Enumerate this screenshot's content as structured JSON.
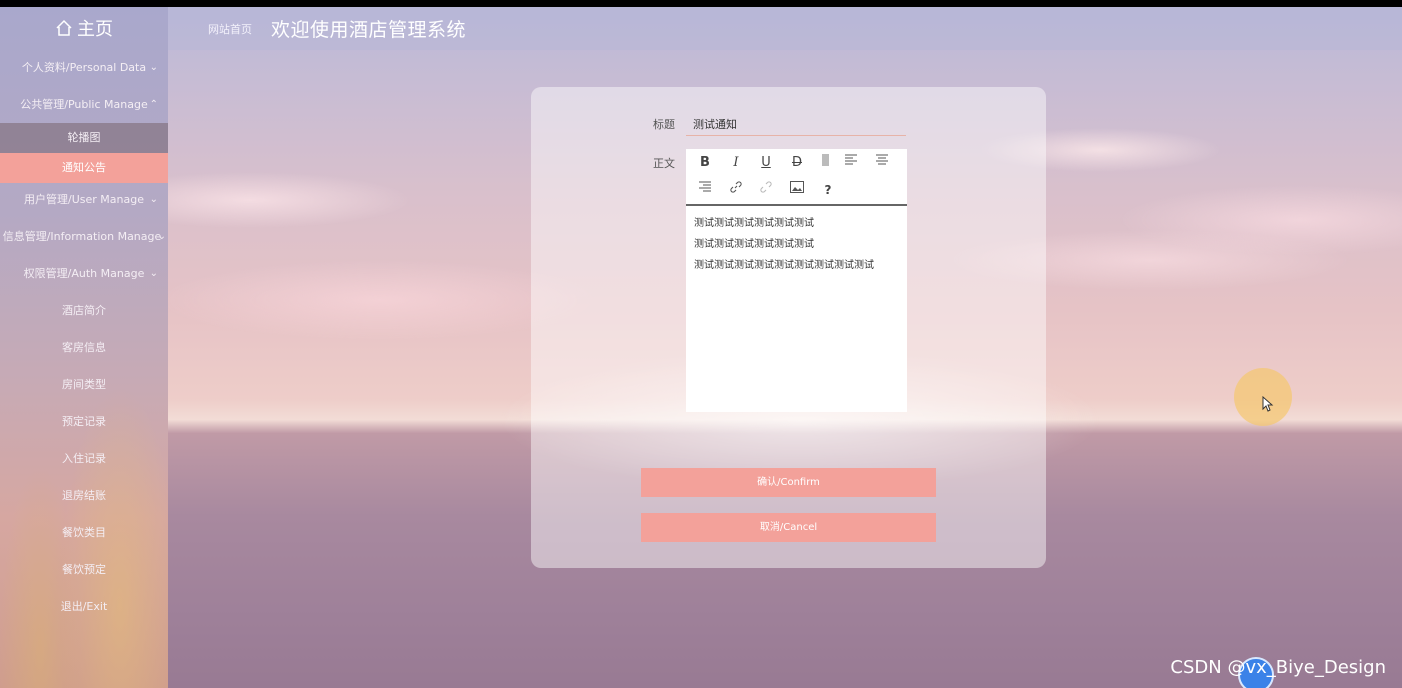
{
  "sidebar": {
    "brand": "主页",
    "items": [
      {
        "label": "个人资料/Personal Data",
        "chev": "⌄"
      },
      {
        "label": "公共管理/Public Manage",
        "chev": "⌃"
      },
      {
        "label": "轮播图",
        "chev": ""
      },
      {
        "label": "通知公告",
        "chev": ""
      },
      {
        "label": "用户管理/User Manage",
        "chev": "⌄"
      },
      {
        "label": "信息管理/Information Manage",
        "chev": "⌄"
      },
      {
        "label": "权限管理/Auth Manage",
        "chev": "⌄"
      },
      {
        "label": "酒店简介",
        "chev": ""
      },
      {
        "label": "客房信息",
        "chev": ""
      },
      {
        "label": "房间类型",
        "chev": ""
      },
      {
        "label": "预定记录",
        "chev": ""
      },
      {
        "label": "入住记录",
        "chev": ""
      },
      {
        "label": "退房结账",
        "chev": ""
      },
      {
        "label": "餐饮类目",
        "chev": ""
      },
      {
        "label": "餐饮预定",
        "chev": ""
      },
      {
        "label": "退出/Exit",
        "chev": ""
      }
    ]
  },
  "header": {
    "crumb": "网站首页",
    "title": "欢迎使用酒店管理系统"
  },
  "form": {
    "title_label": "标题",
    "title_value": "测试通知",
    "body_label": "正文",
    "body_lines": [
      "测试测试测试测试测试测试",
      "测试测试测试测试测试测试",
      "测试测试测试测试测试测试测试测试测试"
    ],
    "toolbar": {
      "bold": "B",
      "italic": "I",
      "underline": "U",
      "strike": "D",
      "help": "?"
    },
    "confirm_label": "确认/Confirm",
    "cancel_label": "取消/Cancel"
  },
  "watermark": "CSDN @vx_Biye_Design",
  "colors": {
    "accent": "#f3a19a",
    "sidebar_top": "#a9a8cc"
  }
}
